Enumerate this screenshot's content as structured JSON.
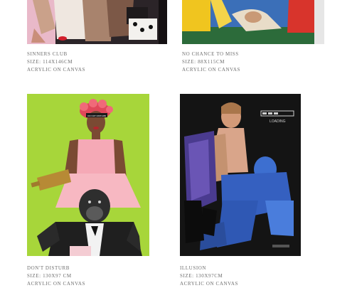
{
  "artworks": [
    {
      "title": "SINNERS CLUB",
      "size": "SIZE: 114X146CM",
      "medium": "ACRYLIC ON CANVAS"
    },
    {
      "title": "NO CHANCE TO MISS",
      "size": "SIZE: 88X115CM",
      "medium": "ACRYLIC ON CANVAS"
    },
    {
      "title": "DON'T DISTURB",
      "size": "SIZE: 130X97 CM",
      "medium": "ACRYLIC ON CANVAS",
      "sign_text": "DO NOT DISTURB"
    },
    {
      "title": "ILLUSION",
      "size": "SIZE: 130X97CM",
      "medium": "ACRYLIC ON CANVAS",
      "loading_text": "LOADING"
    }
  ]
}
